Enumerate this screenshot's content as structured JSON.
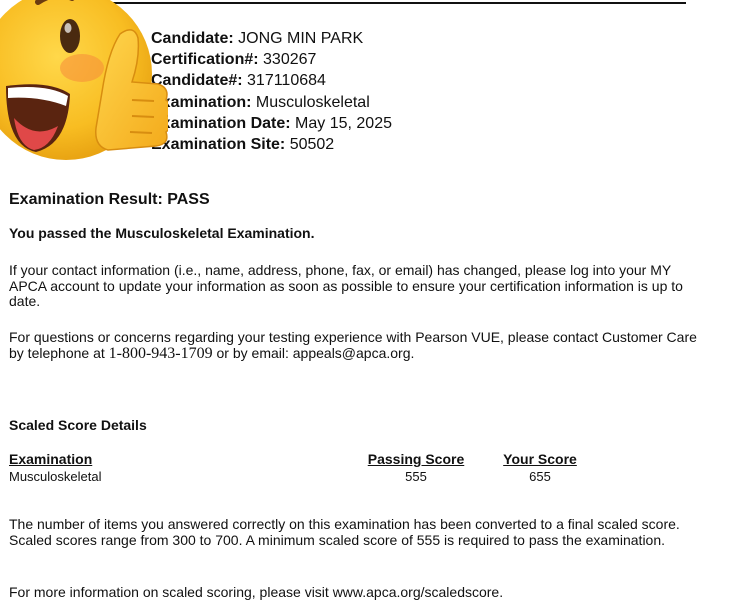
{
  "candidate": {
    "rows": [
      {
        "label": "Candidate:",
        "value": " JONG MIN PARK"
      },
      {
        "label": "Certification#:",
        "value": " 330267"
      },
      {
        "label": "Candidate#:",
        "value": " 317110684"
      },
      {
        "label": "Examination:",
        "value": " Musculoskeletal"
      },
      {
        "label": "Examination Date:",
        "value": " May 15, 2025"
      },
      {
        "label": "Examination Site:",
        "value": " 50502"
      }
    ]
  },
  "result": {
    "heading": "Examination Result: PASS",
    "passed_text": "You passed the Musculoskeletal Examination."
  },
  "paragraphs": {
    "contact": "If your contact information (i.e., name, address, phone, fax, or email) has changed, please log into your MY APCA account to update your information as soon as possible to ensure your certification information is up to date.",
    "questions_before": "For questions or concerns regarding your testing experience with Pearson VUE, please contact Customer Care by telephone at ",
    "phone": "1-800-943-1709",
    "questions_after": " or by email: appeals@apca.org.",
    "scaled_explanation": "The number of items you answered correctly on this examination has been converted to a final scaled score. Scaled scores range from 300 to 700. A minimum scaled score of 555 is required to pass the examination.",
    "more_info": "For more information on scaled scoring, please visit www.apca.org/scaledscore."
  },
  "score_details": {
    "heading": "Scaled Score Details",
    "headers": {
      "exam": "Examination",
      "passing": "Passing Score",
      "yours": "Your Score"
    },
    "row": {
      "exam": "Musculoskeletal",
      "passing": "555",
      "yours": "655"
    }
  },
  "overlay": {
    "icon": "thumbs-up-emoji",
    "face_color": "#f7b81c",
    "hand_color": "#f9b625"
  }
}
